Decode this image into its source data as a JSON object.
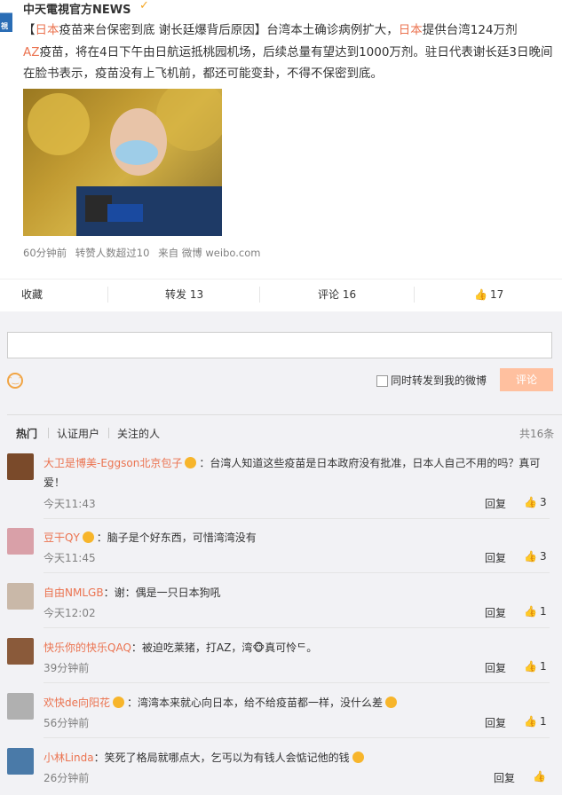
{
  "post": {
    "logo_text": "視",
    "author": "中天電視官方NEWS",
    "text_bracket_open": "【",
    "text_japan1": "日本",
    "text_part1": "疫苗来台保密到底 谢长廷爆背后原因】台湾本土确诊病例扩大，",
    "text_japan2": "日本",
    "text_part2": "提供台湾124万剂",
    "text_az": "AZ",
    "text_part3": "疫苗，将在4日下午由日航运抵桃园机场，后续总量有望达到1000万剂。驻日代表谢长廷3日晚间在脸书表示，疫苗没有上飞机前，都还可能变卦，不得不保密到底。",
    "time": "60分钟前",
    "reposts_note": "转赞人数超过10",
    "source": "来自 微博 weibo.com"
  },
  "actions": {
    "favorite": "收藏",
    "repost": "转发 13",
    "comment": "评论 16",
    "like": "17"
  },
  "composer": {
    "also_repost": "同时转发到我的微博",
    "submit": "评论"
  },
  "tabs": {
    "hot": "热门",
    "verified": "认证用户",
    "following": "关注的人",
    "total": "共16条"
  },
  "comments": [
    {
      "name": "大卫是博美-Eggson北京包子",
      "text": "：台湾人知道这些疫苗是日本政府没有批准，日本人自己不用的吗？真可爱！",
      "time": "今天11:43",
      "reply": "回复",
      "likes": "3",
      "avatar_color": "#7a4a2a"
    },
    {
      "name": "豆干QY",
      "text": "：脑子是个好东西，可惜湾湾没有",
      "time": "今天11:45",
      "reply": "回复",
      "likes": "3",
      "avatar_color": "#d9a0a8"
    },
    {
      "name": "自由NMLGB",
      "text": "：谢：偶是一只日本狗吼",
      "time": "今天12:02",
      "reply": "回复",
      "likes": "1",
      "avatar_color": "#c9b8a8"
    },
    {
      "name": "快乐你的快乐QAQ",
      "text": "：被迫吃莱猪，打AZ，湾🐵真可怜ᄃ。",
      "time": "39分钟前",
      "reply": "回复",
      "likes": "1",
      "avatar_color": "#8a5a3a"
    },
    {
      "name": "欢快de向阳花",
      "text": "：湾湾本来就心向日本，给不给疫苗都一样，没什么差",
      "time": "56分钟前",
      "reply": "回复",
      "likes": "1",
      "avatar_color": "#b0b0b0"
    },
    {
      "name": "小林Linda",
      "text": "：笑死了格局就哪点大，乞丐以为有钱人会惦记他的钱",
      "time": "26分钟前",
      "reply": "回复",
      "likes": "",
      "avatar_color": "#4a7aa8"
    }
  ]
}
